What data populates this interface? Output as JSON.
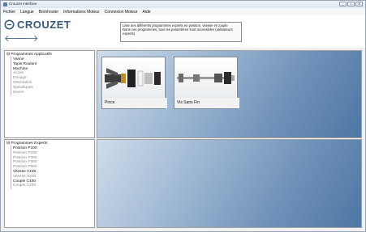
{
  "window": {
    "title": "Crouzet Interface",
    "buttons": [
      "_",
      "□",
      "✕"
    ]
  },
  "menu": [
    "Fichier",
    "Langue",
    "Bornhoster",
    "Informations Moteur",
    "Connexion Moteur",
    "Aide"
  ],
  "logo": {
    "text": "CROUZET"
  },
  "info": {
    "line1": "Liste des différents programmes experts en position, vitesse et couple",
    "line2": "Dans ces programmes, tous les paramètres sont accessibles (utilisateurs experts)"
  },
  "tree_applicatifs": {
    "root": "Programmes Applicatifs",
    "items": [
      {
        "label": "Vanne",
        "dim": false
      },
      {
        "label": "Tapis Roulant",
        "dim": false
      },
      {
        "label": "Machine",
        "dim": false
      },
      {
        "label": "Accès",
        "dim": true
      },
      {
        "label": "Dosage",
        "dim": true
      },
      {
        "label": "Orientation",
        "dim": true
      },
      {
        "label": "Spécifiques",
        "dim": true
      },
      {
        "label": "Divers",
        "dim": true
      }
    ]
  },
  "tree_experts": {
    "root": "Programmes Experts",
    "items": [
      {
        "label": "Position P100",
        "dim": false
      },
      {
        "label": "Position P200",
        "dim": true
      },
      {
        "label": "Position P300",
        "dim": true
      },
      {
        "label": "Position P400",
        "dim": true
      },
      {
        "label": "Position P500",
        "dim": true
      },
      {
        "label": "Vitesse V100",
        "dim": false
      },
      {
        "label": "Vitesse V200",
        "dim": true
      },
      {
        "label": "Couple C100",
        "dim": false
      },
      {
        "label": "Couple C200",
        "dim": true
      }
    ]
  },
  "tiles": [
    {
      "label": "Pince",
      "icon": "gripper-icon"
    },
    {
      "label": "Vis Sans Fin",
      "icon": "worm-screw-icon"
    }
  ]
}
